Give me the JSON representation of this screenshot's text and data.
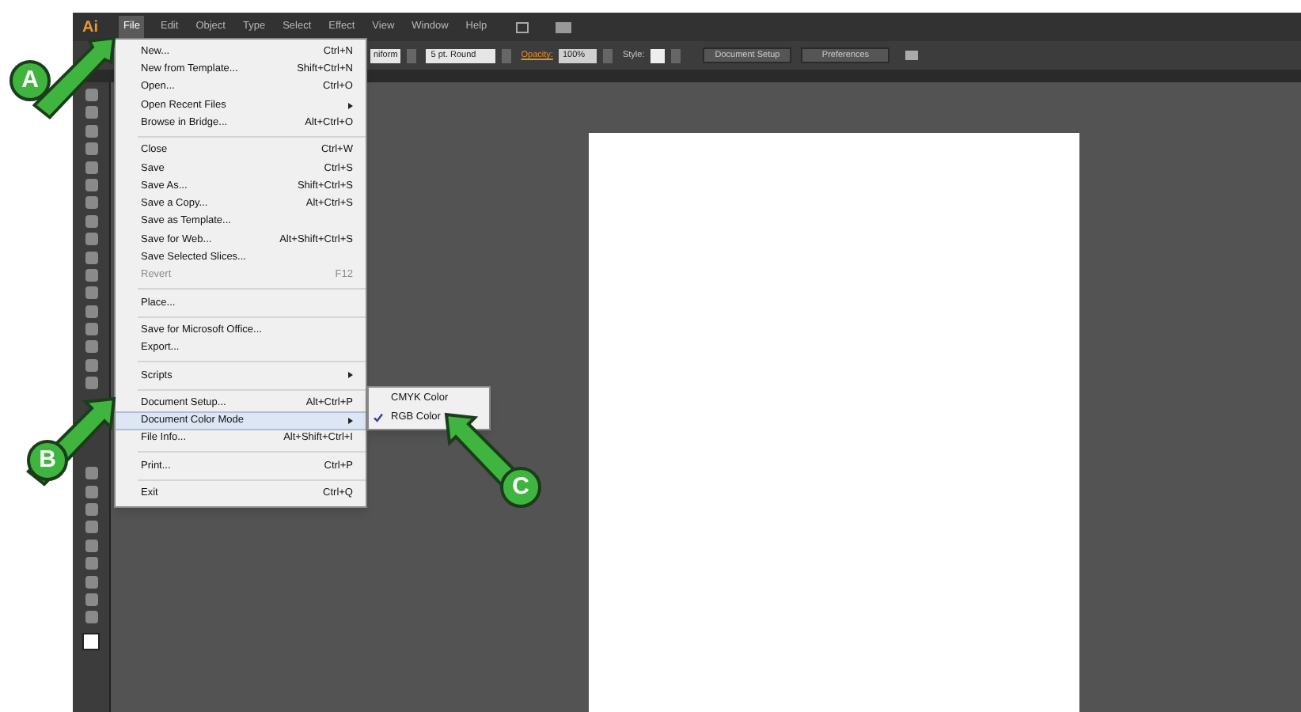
{
  "app": {
    "logo": "Ai"
  },
  "menu_bar": [
    {
      "label": "File",
      "selected": true
    },
    {
      "label": "Edit",
      "selected": false
    },
    {
      "label": "Object",
      "selected": false
    },
    {
      "label": "Type",
      "selected": false
    },
    {
      "label": "Select",
      "selected": false
    },
    {
      "label": "Effect",
      "selected": false
    },
    {
      "label": "View",
      "selected": false
    },
    {
      "label": "Window",
      "selected": false
    },
    {
      "label": "Help",
      "selected": false
    }
  ],
  "control_bar": {
    "stroke_profile": "niform",
    "brush": "5 pt. Round",
    "opacity_label": "Opacity:",
    "opacity": "100%",
    "style_label": "Style:",
    "buttons": [
      "Document Setup",
      "Preferences"
    ]
  },
  "file_menu": [
    [
      {
        "label": "New...",
        "shortcut": "Ctrl+N",
        "submenu": false,
        "disabled": false,
        "selected": false
      },
      {
        "label": "New from Template...",
        "shortcut": "Shift+Ctrl+N",
        "submenu": false,
        "disabled": false,
        "selected": false
      },
      {
        "label": "Open...",
        "shortcut": "Ctrl+O",
        "submenu": false,
        "disabled": false,
        "selected": false
      },
      {
        "label": "Open Recent Files",
        "submenu": true,
        "disabled": false,
        "selected": false
      },
      {
        "label": "Browse in Bridge...",
        "shortcut": "Alt+Ctrl+O",
        "submenu": false,
        "disabled": false,
        "selected": false
      }
    ],
    [
      {
        "label": "Close",
        "shortcut": "Ctrl+W",
        "submenu": false,
        "disabled": false,
        "selected": false
      },
      {
        "label": "Save",
        "shortcut": "Ctrl+S",
        "submenu": false,
        "disabled": false,
        "selected": false
      },
      {
        "label": "Save As...",
        "shortcut": "Shift+Ctrl+S",
        "submenu": false,
        "disabled": false,
        "selected": false
      },
      {
        "label": "Save a Copy...",
        "shortcut": "Alt+Ctrl+S",
        "submenu": false,
        "disabled": false,
        "selected": false
      },
      {
        "label": "Save as Template...",
        "submenu": false,
        "disabled": false,
        "selected": false
      },
      {
        "label": "Save for Web...",
        "shortcut": "Alt+Shift+Ctrl+S",
        "submenu": false,
        "disabled": false,
        "selected": false
      },
      {
        "label": "Save Selected Slices...",
        "submenu": false,
        "disabled": false,
        "selected": false
      },
      {
        "label": "Revert",
        "shortcut": "F12",
        "submenu": false,
        "disabled": true,
        "selected": false
      }
    ],
    [
      {
        "label": "Place...",
        "submenu": false,
        "disabled": false,
        "selected": false
      }
    ],
    [
      {
        "label": "Save for Microsoft Office...",
        "submenu": false,
        "disabled": false,
        "selected": false
      },
      {
        "label": "Export...",
        "submenu": false,
        "disabled": false,
        "selected": false
      }
    ],
    [
      {
        "label": "Scripts",
        "submenu": true,
        "disabled": false,
        "selected": false
      }
    ],
    [
      {
        "label": "Document Setup...",
        "shortcut": "Alt+Ctrl+P",
        "submenu": false,
        "disabled": false,
        "selected": false
      },
      {
        "label": "Document Color Mode",
        "submenu": true,
        "disabled": false,
        "selected": true
      },
      {
        "label": "File Info...",
        "shortcut": "Alt+Shift+Ctrl+I",
        "submenu": false,
        "disabled": false,
        "selected": false
      }
    ],
    [
      {
        "label": "Print...",
        "shortcut": "Ctrl+P",
        "submenu": false,
        "disabled": false,
        "selected": false
      }
    ],
    [
      {
        "label": "Exit",
        "shortcut": "Ctrl+Q",
        "submenu": false,
        "disabled": false,
        "selected": false
      }
    ]
  ],
  "color_mode_submenu": [
    {
      "label": "CMYK Color",
      "checked": false
    },
    {
      "label": "RGB Color",
      "checked": true
    }
  ],
  "callouts": [
    "A",
    "B",
    "C"
  ]
}
